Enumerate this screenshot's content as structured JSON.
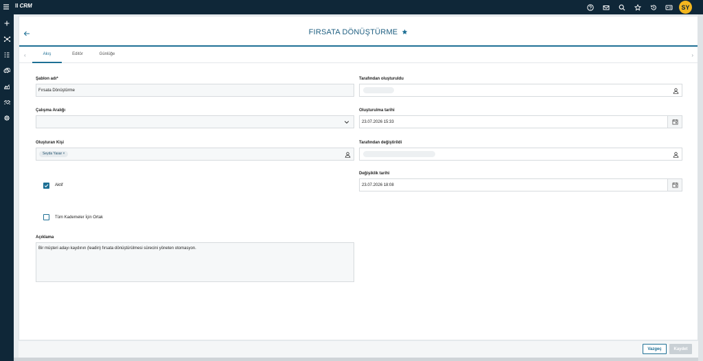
{
  "app": {
    "logo_mark": "ll",
    "logo_text": "CRM",
    "menu_icon": "hamburger-icon",
    "user_initials": "SY"
  },
  "header_icons": [
    "help-icon",
    "mail-icon",
    "search-icon",
    "star-icon",
    "history-icon",
    "id-card-icon"
  ],
  "sidebar_icons": [
    "plus-icon",
    "network-icon",
    "list-icon",
    "cars-icon",
    "chart-icon",
    "handshake-icon",
    "gear-icon"
  ],
  "page": {
    "title": "FIRSATA DÖNÜŞTÜRME",
    "favorite_icon": "star-filled-icon"
  },
  "tabs": [
    {
      "label": "Akış",
      "active": true
    },
    {
      "label": "Editör",
      "active": false
    },
    {
      "label": "Günlüğe",
      "active": false
    }
  ],
  "form": {
    "template_name": {
      "label": "Şablon adı*",
      "value": "Fırsata Dönüştürme"
    },
    "work_interval": {
      "label": "Çalışma Aralığı",
      "value": ""
    },
    "creator": {
      "label": "Oluşturan Kişi",
      "chip": "Seyda Yasar"
    },
    "created_by": {
      "label": "Tarafından oluşturuldu"
    },
    "created_date": {
      "label": "Oluşturulma tarihi",
      "value": "23.07.2026 15:33"
    },
    "modified_by": {
      "label": "Tarafından değiştirildi"
    },
    "modified_date": {
      "label": "Değişiklik tarihi",
      "value": "23.07.2026 18:08"
    },
    "active": {
      "label": "Aktif",
      "checked": true
    },
    "all_levels": {
      "label": "Tüm Kademeler İçin Ortak",
      "checked": false
    },
    "description": {
      "label": "Açıklama",
      "value": "Bir müşteri adayı kaydının (leadin) fırsata dönüştürülmesi sürecini yöneten otomasyon."
    }
  },
  "footer": {
    "cancel_label": "Vazgeç",
    "save_label": "Kaydet"
  },
  "colors": {
    "accent": "#1d6f94",
    "topbar": "#0f2738",
    "avatar": "#f3b61f"
  }
}
